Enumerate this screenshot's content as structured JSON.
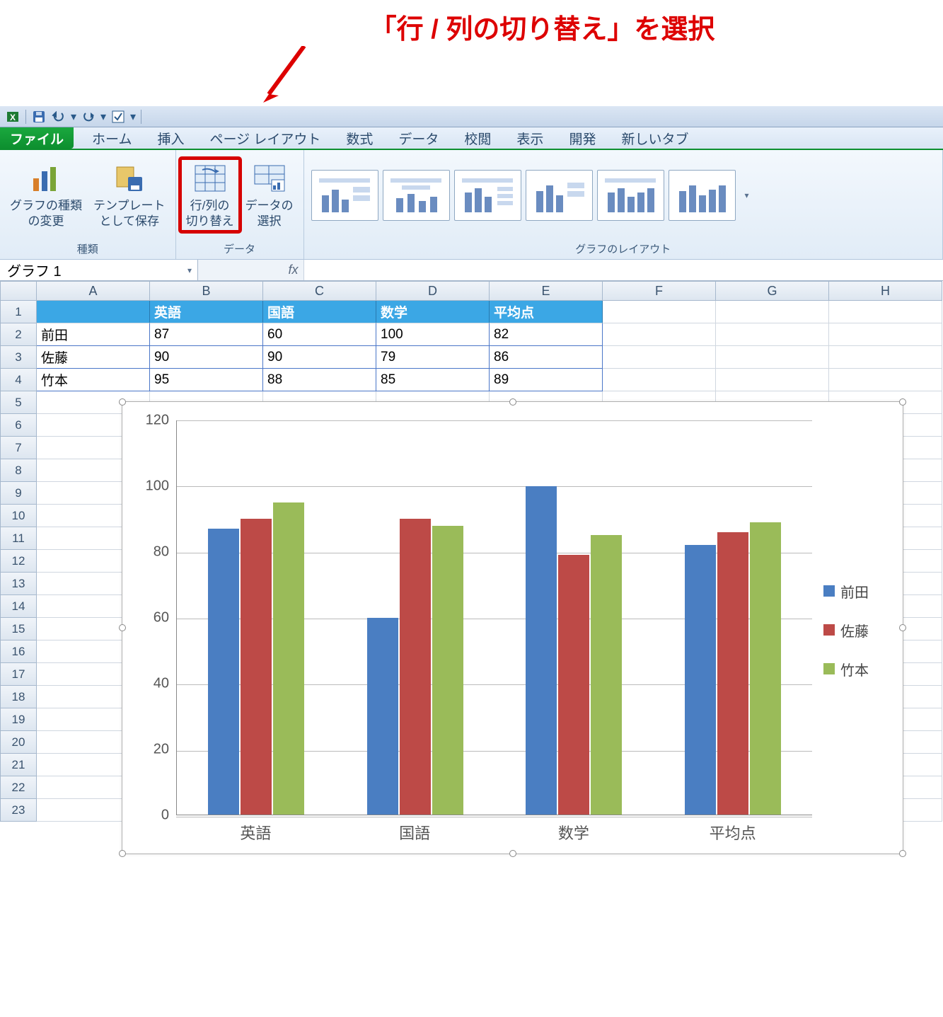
{
  "annotation": "「行 / 列の切り替え」を選択",
  "qat": {
    "icons": [
      "excel",
      "save",
      "undo",
      "redo",
      "checkbox"
    ]
  },
  "tabs": {
    "file": "ファイル",
    "items": [
      "ホーム",
      "挿入",
      "ページ レイアウト",
      "数式",
      "データ",
      "校閲",
      "表示",
      "開発",
      "新しいタブ"
    ]
  },
  "ribbon": {
    "group_type": {
      "label": "種類",
      "change_chart": "グラフの種類\nの変更",
      "save_template": "テンプレート\nとして保存"
    },
    "group_data": {
      "label": "データ",
      "switch_rowcol": "行/列の\n切り替え",
      "select_data": "データの\n選択"
    },
    "group_layout": {
      "label": "グラフのレイアウト"
    }
  },
  "namebox": "グラフ 1",
  "fx": "fx",
  "columns": [
    "A",
    "B",
    "C",
    "D",
    "E",
    "F",
    "G",
    "H"
  ],
  "row_numbers": [
    "1",
    "2",
    "3",
    "4",
    "5",
    "6",
    "7",
    "8",
    "9",
    "10",
    "11",
    "12",
    "13",
    "14",
    "15",
    "16",
    "17",
    "18",
    "19",
    "20",
    "21",
    "22",
    "23"
  ],
  "sheet": {
    "headers": [
      "",
      "英語",
      "国語",
      "数学",
      "平均点"
    ],
    "rows": [
      {
        "name": "前田",
        "vals": [
          "87",
          "60",
          "100",
          "82"
        ]
      },
      {
        "name": "佐藤",
        "vals": [
          "90",
          "90",
          "79",
          "86"
        ]
      },
      {
        "name": "竹本",
        "vals": [
          "95",
          "88",
          "85",
          "89"
        ]
      }
    ]
  },
  "chart_data": {
    "type": "bar",
    "categories": [
      "英語",
      "国語",
      "数学",
      "平均点"
    ],
    "series": [
      {
        "name": "前田",
        "values": [
          87,
          60,
          100,
          82
        ],
        "color": "#4a7ec2"
      },
      {
        "name": "佐藤",
        "values": [
          90,
          90,
          79,
          86
        ],
        "color": "#bd4a47"
      },
      {
        "name": "竹本",
        "values": [
          95,
          88,
          85,
          89
        ],
        "color": "#9abb59"
      }
    ],
    "ylim": [
      0,
      120
    ],
    "yticks": [
      0,
      20,
      40,
      60,
      80,
      100,
      120
    ]
  }
}
